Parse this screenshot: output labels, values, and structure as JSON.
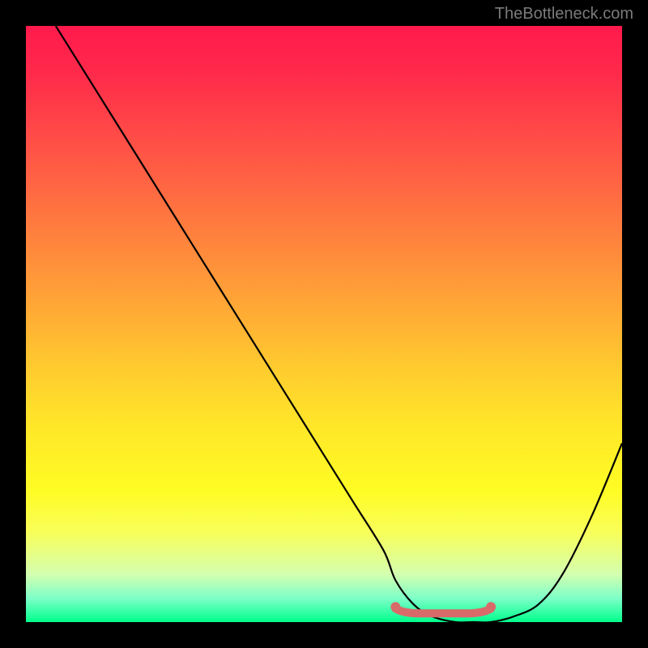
{
  "watermark": "TheBottleneck.com",
  "chart_data": {
    "type": "line",
    "title": "",
    "xlabel": "",
    "ylabel": "",
    "xlim": [
      0,
      100
    ],
    "ylim": [
      0,
      100
    ],
    "series": [
      {
        "name": "bottleneck-curve",
        "x": [
          5,
          10,
          15,
          20,
          25,
          30,
          35,
          40,
          45,
          50,
          55,
          60,
          62,
          65,
          68,
          72,
          75,
          78,
          82,
          86,
          90,
          95,
          100
        ],
        "values": [
          100,
          92,
          84,
          76,
          68,
          60,
          52,
          44,
          36,
          28,
          20,
          12,
          7,
          3,
          1,
          0,
          0,
          0,
          1,
          3,
          8,
          18,
          30
        ]
      },
      {
        "name": "optimal-segment",
        "x": [
          62,
          78
        ],
        "values": [
          2,
          2
        ]
      }
    ],
    "gradient_stops": [
      {
        "pos": 0,
        "color": "#ff1a4d"
      },
      {
        "pos": 50,
        "color": "#ffcd2e"
      },
      {
        "pos": 100,
        "color": "#00ff8c"
      }
    ]
  }
}
